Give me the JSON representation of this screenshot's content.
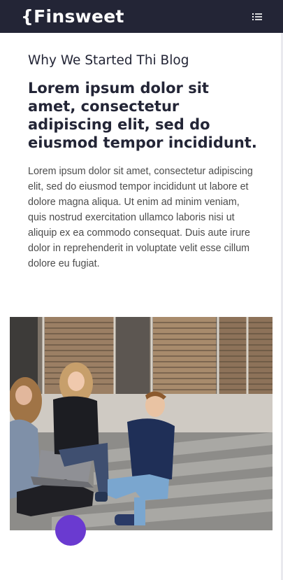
{
  "nav": {
    "logo": "{Finsweet",
    "menu_icon": "list-menu-icon",
    "background": "#232536"
  },
  "content": {
    "eyebrow": "Why We Started Thi Blog",
    "headline": "Lorem ipsum dolor sit amet, consectetur adipiscing elit, sed do eiusmod tempor incididunt.",
    "body": "Lorem ipsum dolor sit amet, consectetur adipiscing elit, sed do eiusmod tempor incididunt ut labore et dolore magna aliqua. Ut enim ad minim veniam, quis nostrud exercitation ullamco laboris nisi ut aliquip ex ea commodo consequat. Duis aute irure dolor in reprehenderit in voluptate velit esse cillum dolore eu fugiat."
  },
  "accent_color": "#6a3ad0"
}
